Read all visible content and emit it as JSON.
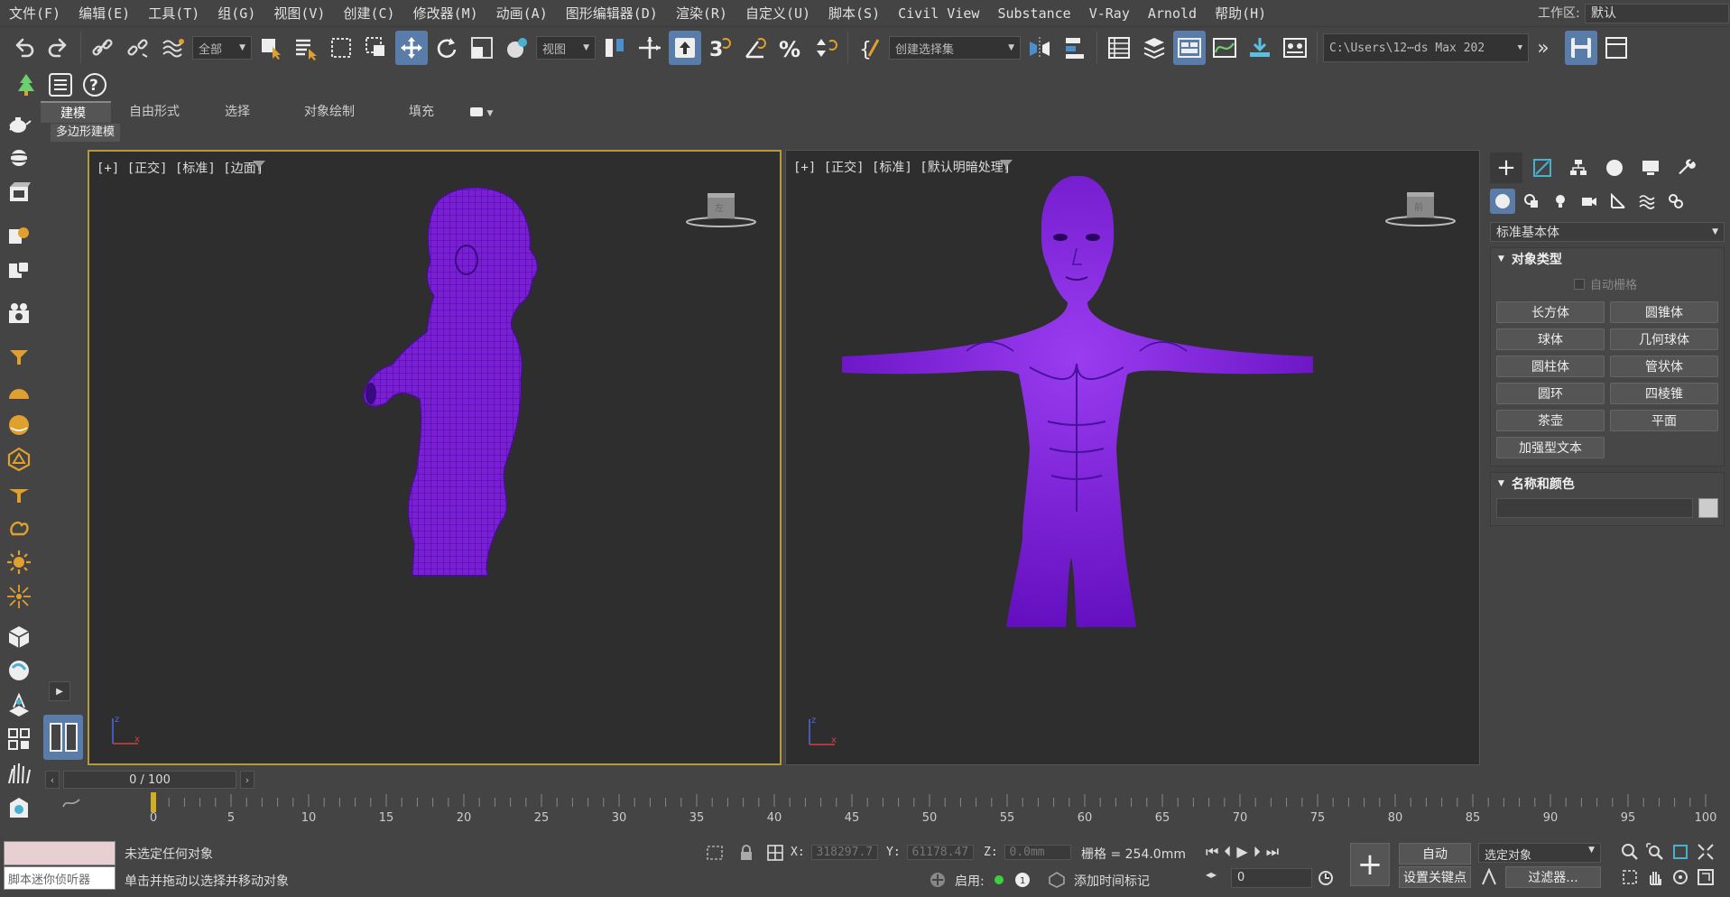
{
  "menu": [
    "文件(F)",
    "编辑(E)",
    "工具(T)",
    "组(G)",
    "视图(V)",
    "创建(C)",
    "修改器(M)",
    "动画(A)",
    "图形编辑器(D)",
    "渲染(R)",
    "自定义(U)",
    "脚本(S)",
    "Civil View",
    "Substance",
    "V-Ray",
    "Arnold",
    "帮助(H)"
  ],
  "workspace": {
    "label": "工作区:",
    "value": "默认"
  },
  "toolbar": {
    "selection_filter": "全部",
    "ref_coord": "视图",
    "named_selection": "创建选择集",
    "path": "C:\\Users\\12⋯ds Max 202"
  },
  "ribbon": {
    "tabs": [
      "建模",
      "自由形式",
      "选择",
      "对象绘制",
      "填充"
    ],
    "active_tab": "建模",
    "subpanel": "多边形建模"
  },
  "viewports": {
    "left": {
      "label": "[+] [正交] [标准] [边面]"
    },
    "right": {
      "label": "[+] [正交] [标准] [默认明暗处理]"
    }
  },
  "command_panel": {
    "category": "标准基本体",
    "object_type_title": "对象类型",
    "autogrid": "自动栅格",
    "primitives": [
      "长方体",
      "圆锥体",
      "球体",
      "几何球体",
      "圆柱体",
      "管状体",
      "圆环",
      "四棱锥",
      "茶壶",
      "平面",
      "加强型文本"
    ],
    "name_color_title": "名称和颜色"
  },
  "timeline": {
    "frame_display": "0 / 100",
    "ticks": [
      "0",
      "5",
      "10",
      "15",
      "20",
      "25",
      "30",
      "35",
      "40",
      "45",
      "50",
      "55",
      "60",
      "65",
      "70",
      "75",
      "80",
      "85",
      "90",
      "95",
      "100"
    ]
  },
  "status": {
    "maxscript": "脚本迷你侦听器",
    "line1": "未选定任何对象",
    "line2": "单击并拖动以选择并移动对象",
    "x_label": "X:",
    "x": "318297.7",
    "y_label": "Y:",
    "y": "61178.47",
    "z_label": "Z:",
    "z": "0.0mm",
    "grid": "栅格 = 254.0mm",
    "enable_label": "启用:",
    "add_time_tag": "添加时间标记",
    "auto_key": "自动",
    "set_key": "设置关键点",
    "key_filter_select": "选定对象",
    "filters": "过滤器...",
    "frame_value": "0"
  },
  "colors": {
    "accent": "#5a7ca8",
    "model": "#7a1fd6",
    "viewport_border": "#b49a3a"
  }
}
